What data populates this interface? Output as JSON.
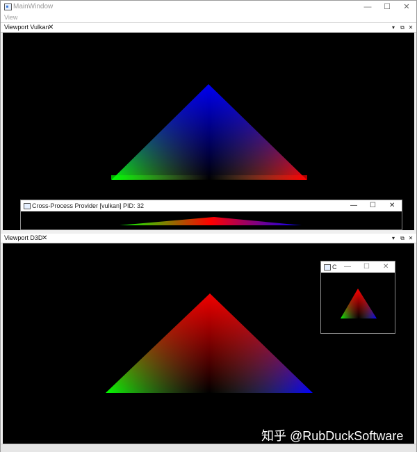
{
  "window": {
    "title": "MainWindow",
    "minimize": "—",
    "maximize": "☐",
    "close": "✕"
  },
  "menu": {
    "view": "View"
  },
  "docks": {
    "vulkan": {
      "tab": "Viewport Vulkan",
      "close": "✕",
      "arrow": "▾",
      "float": "⧉",
      "dock_close": "✕"
    },
    "d3d": {
      "tab": "Viewport D3D",
      "close": "✕",
      "arrow": "▾",
      "float": "⧉",
      "dock_close": "✕"
    }
  },
  "cross_process_window": {
    "title": "Cross-Process Provider [vulkan] PID: 32",
    "minimize": "—",
    "maximize": "☐",
    "close": "✕"
  },
  "small_window": {
    "title": "C",
    "minimize": "—",
    "maximize": "☐",
    "close": "✕"
  },
  "watermark": "知乎 @RubDuckSoftware",
  "colors": {
    "red": "#ff0000",
    "green": "#00ff00",
    "blue": "#0000ff",
    "viewport_bg": "#000000"
  }
}
